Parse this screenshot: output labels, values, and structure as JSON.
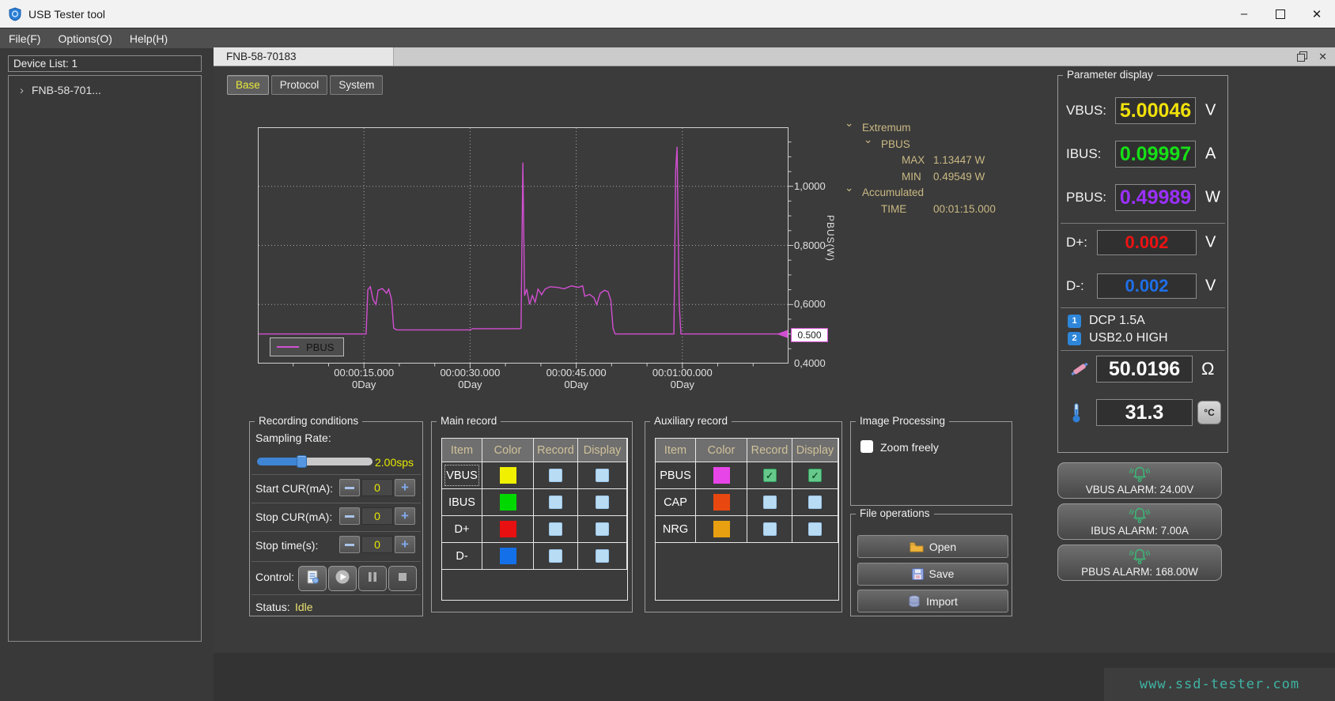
{
  "window": {
    "title": "USB Tester tool"
  },
  "menu": {
    "items": [
      "File(F)",
      "Options(O)",
      "Help(H)"
    ]
  },
  "device_panel": {
    "header": "Device List: 1",
    "tree_items": [
      {
        "expander": "›",
        "label": "FNB-58-701..."
      }
    ]
  },
  "subwindow": {
    "tab_title": "FNB-58-70183"
  },
  "view_tabs": [
    {
      "label": "Base",
      "active": true
    },
    {
      "label": "Protocol",
      "active": false
    },
    {
      "label": "System",
      "active": false
    }
  ],
  "chart_data": {
    "type": "line",
    "title": "",
    "xlabel": "",
    "ylabel": "PBUS(W)",
    "xlim": [
      0,
      75
    ],
    "ylim": [
      0.4,
      1.2
    ],
    "grid": true,
    "x_ticks": [
      {
        "t": 15,
        "label": "00:00:15.000",
        "day": "0Day"
      },
      {
        "t": 30,
        "label": "00:00:30.000",
        "day": "0Day"
      },
      {
        "t": 45,
        "label": "00:00:45.000",
        "day": "0Day"
      },
      {
        "t": 60,
        "label": "00:01:00.000",
        "day": "0Day"
      }
    ],
    "y_ticks": [
      {
        "v": 1.0,
        "label": "1,0000"
      },
      {
        "v": 0.8,
        "label": "0,8000"
      },
      {
        "v": 0.6,
        "label": "0,6000"
      },
      {
        "v": 0.4,
        "label": "0,4000"
      }
    ],
    "legend": {
      "label": "PBUS",
      "position": "bottom-left"
    },
    "marker": {
      "value": 0.5,
      "label": "0.500"
    },
    "series": [
      {
        "name": "PBUS",
        "color": "#d24fd2",
        "points": [
          [
            0,
            0.5
          ],
          [
            15.3,
            0.5
          ],
          [
            15.55,
            0.65
          ],
          [
            15.9,
            0.66
          ],
          [
            16.3,
            0.615
          ],
          [
            16.7,
            0.6
          ],
          [
            17.0,
            0.648
          ],
          [
            17.6,
            0.654
          ],
          [
            18.2,
            0.638
          ],
          [
            18.5,
            0.652
          ],
          [
            18.9,
            0.617
          ],
          [
            19.2,
            0.52
          ],
          [
            19.6,
            0.514
          ],
          [
            30.0,
            0.514
          ],
          [
            30.4,
            0.518
          ],
          [
            36.9,
            0.518
          ],
          [
            37.2,
            0.52
          ],
          [
            37.45,
            1.08
          ],
          [
            37.7,
            0.63
          ],
          [
            38.0,
            0.652
          ],
          [
            38.4,
            0.6
          ],
          [
            38.8,
            0.63
          ],
          [
            39.2,
            0.608
          ],
          [
            39.6,
            0.652
          ],
          [
            40.1,
            0.633
          ],
          [
            40.6,
            0.652
          ],
          [
            41.3,
            0.66
          ],
          [
            42.3,
            0.658
          ],
          [
            43.3,
            0.653
          ],
          [
            44.3,
            0.663
          ],
          [
            45.3,
            0.658
          ],
          [
            45.9,
            0.663
          ],
          [
            46.2,
            0.628
          ],
          [
            46.9,
            0.634
          ],
          [
            47.5,
            0.623
          ],
          [
            47.9,
            0.6
          ],
          [
            48.4,
            0.638
          ],
          [
            49.0,
            0.648
          ],
          [
            49.5,
            0.643
          ],
          [
            49.9,
            0.613
          ],
          [
            50.2,
            0.52
          ],
          [
            50.5,
            0.5
          ],
          [
            58.8,
            0.5
          ],
          [
            59.05,
            1.05
          ],
          [
            59.25,
            1.134
          ],
          [
            59.55,
            0.6
          ],
          [
            59.8,
            0.5
          ],
          [
            75,
            0.5
          ]
        ]
      }
    ]
  },
  "stats_tree": {
    "rows": [
      {
        "indent": 0,
        "chevron": true,
        "label": "Extremum",
        "value": ""
      },
      {
        "indent": 1,
        "chevron": true,
        "label": "PBUS",
        "value": ""
      },
      {
        "indent": 2,
        "chevron": false,
        "label": "MAX",
        "value": "1.13447 W"
      },
      {
        "indent": 2,
        "chevron": false,
        "label": "MIN",
        "value": "0.49549 W"
      },
      {
        "indent": 0,
        "chevron": true,
        "label": "Accumulated",
        "value": ""
      },
      {
        "indent": 1,
        "chevron": false,
        "label": "TIME",
        "value": "00:01:15.000"
      }
    ]
  },
  "recording": {
    "title": "Recording conditions",
    "sampling_label": "Sampling Rate:",
    "sampling_value": "2.00sps",
    "slider_percent": 39,
    "spin_rows": [
      {
        "label": "Start CUR(mA):",
        "value": "0"
      },
      {
        "label": "Stop CUR(mA):",
        "value": "0"
      },
      {
        "label": "Stop time(s):",
        "value": "0"
      }
    ],
    "control_label": "Control:",
    "control_buttons": [
      "record-log",
      "play",
      "pause",
      "stop"
    ],
    "status_label": "Status:",
    "status_value": "Idle"
  },
  "main_record": {
    "title": "Main record",
    "headers": [
      "Item",
      "Color",
      "Record",
      "Display"
    ],
    "rows": [
      {
        "item": "VBUS",
        "color": "#f0f000",
        "record": false,
        "display": false,
        "selected": true
      },
      {
        "item": "IBUS",
        "color": "#00d800",
        "record": false,
        "display": false,
        "selected": false
      },
      {
        "item": "D+",
        "color": "#e81010",
        "record": false,
        "display": false,
        "selected": false
      },
      {
        "item": "D-",
        "color": "#1470e8",
        "record": false,
        "display": false,
        "selected": false
      }
    ]
  },
  "aux_record": {
    "title": "Auxiliary record",
    "headers": [
      "Item",
      "Color",
      "Record",
      "Display"
    ],
    "rows": [
      {
        "item": "PBUS",
        "color": "#e845e8",
        "record": true,
        "display": true,
        "selected": false
      },
      {
        "item": "CAP",
        "color": "#e84810",
        "record": false,
        "display": false,
        "selected": false
      },
      {
        "item": "NRG",
        "color": "#e8a010",
        "record": false,
        "display": false,
        "selected": false
      }
    ]
  },
  "image_processing": {
    "title": "Image Processing",
    "checkbox_label": "Zoom freely",
    "checked": false
  },
  "file_ops": {
    "title": "File operations",
    "buttons": [
      {
        "icon": "folder",
        "label": "Open"
      },
      {
        "icon": "save",
        "label": "Save"
      },
      {
        "icon": "database",
        "label": "Import"
      }
    ]
  },
  "parameters": {
    "title": "Parameter display",
    "vbus": {
      "label": "VBUS:",
      "value": "5.00046",
      "unit": "V",
      "color": "#f0e00a"
    },
    "ibus": {
      "label": "IBUS:",
      "value": "0.09997",
      "unit": "A",
      "color": "#16e016"
    },
    "pbus": {
      "label": "PBUS:",
      "value": "0.49989",
      "unit": "W",
      "color": "#9b30ff"
    },
    "dplus": {
      "label": "D+:",
      "value": "0.002",
      "unit": "V",
      "color": "#ee1212"
    },
    "dminus": {
      "label": "D-:",
      "value": "0.002",
      "unit": "V",
      "color": "#1f6fe8"
    },
    "badges": [
      {
        "num": "1",
        "text": "DCP 1.5A"
      },
      {
        "num": "2",
        "text": "USB2.0 HIGH"
      }
    ],
    "resistance": {
      "value": "50.0196",
      "unit": "Ω"
    },
    "temperature": {
      "value": "31.3",
      "unit_button": "°C"
    }
  },
  "alarms": [
    {
      "label": "VBUS ALARM: 24.00V"
    },
    {
      "label": "IBUS ALARM: 7.00A"
    },
    {
      "label": "PBUS ALARM: 168.00W"
    }
  ],
  "watermark": "www.ssd-tester.com",
  "colors": {
    "accent_blue": "#3f85d6",
    "series_pbus": "#d24fd2",
    "alarm_green": "#3cb878",
    "value_yellow": "#e8e800"
  }
}
